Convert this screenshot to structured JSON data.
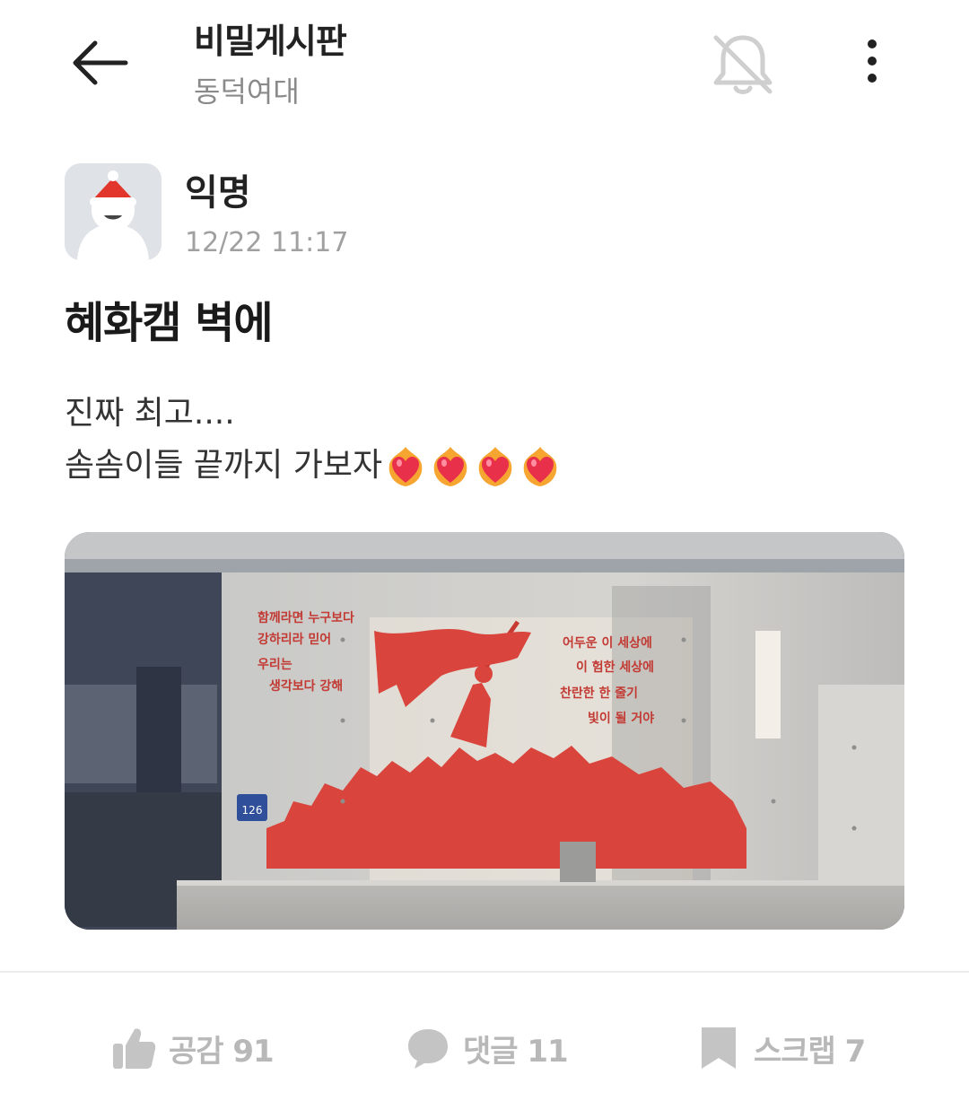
{
  "header": {
    "title": "비밀게시판",
    "subtitle": "동덕여대",
    "back_icon": "arrow-left-icon",
    "bell_icon": "bell-off-icon",
    "more_icon": "more-vertical-icon"
  },
  "post": {
    "author": "익명",
    "time": "12/22 11:17",
    "title": "혜화캠 벽에",
    "body_line1": "진짜 최고....",
    "body_line2": "솜솜이들 끝까지 가보자",
    "emoji": "burning-heart-emoji",
    "emoji_count": 4
  },
  "photo": {
    "mural_left_line1": "함께라면 누구보다",
    "mural_left_line2": "강하리라 믿어",
    "mural_left_line3": "우리는",
    "mural_left_line4": "생각보다 강해",
    "mural_right_line1": "어두운 이 세상에",
    "mural_right_line2": "이 험한 세상에",
    "mural_right_line3": "찬란한 한 줄기",
    "mural_right_line4": "빛이 될 거야",
    "sign_number": "126"
  },
  "actions": {
    "like_label": "공감 91",
    "comment_label": "댓글 11",
    "scrap_label": "스크랩 7"
  },
  "colors": {
    "accent_red": "#d9453d",
    "muted_gray": "#b8b8b8"
  }
}
